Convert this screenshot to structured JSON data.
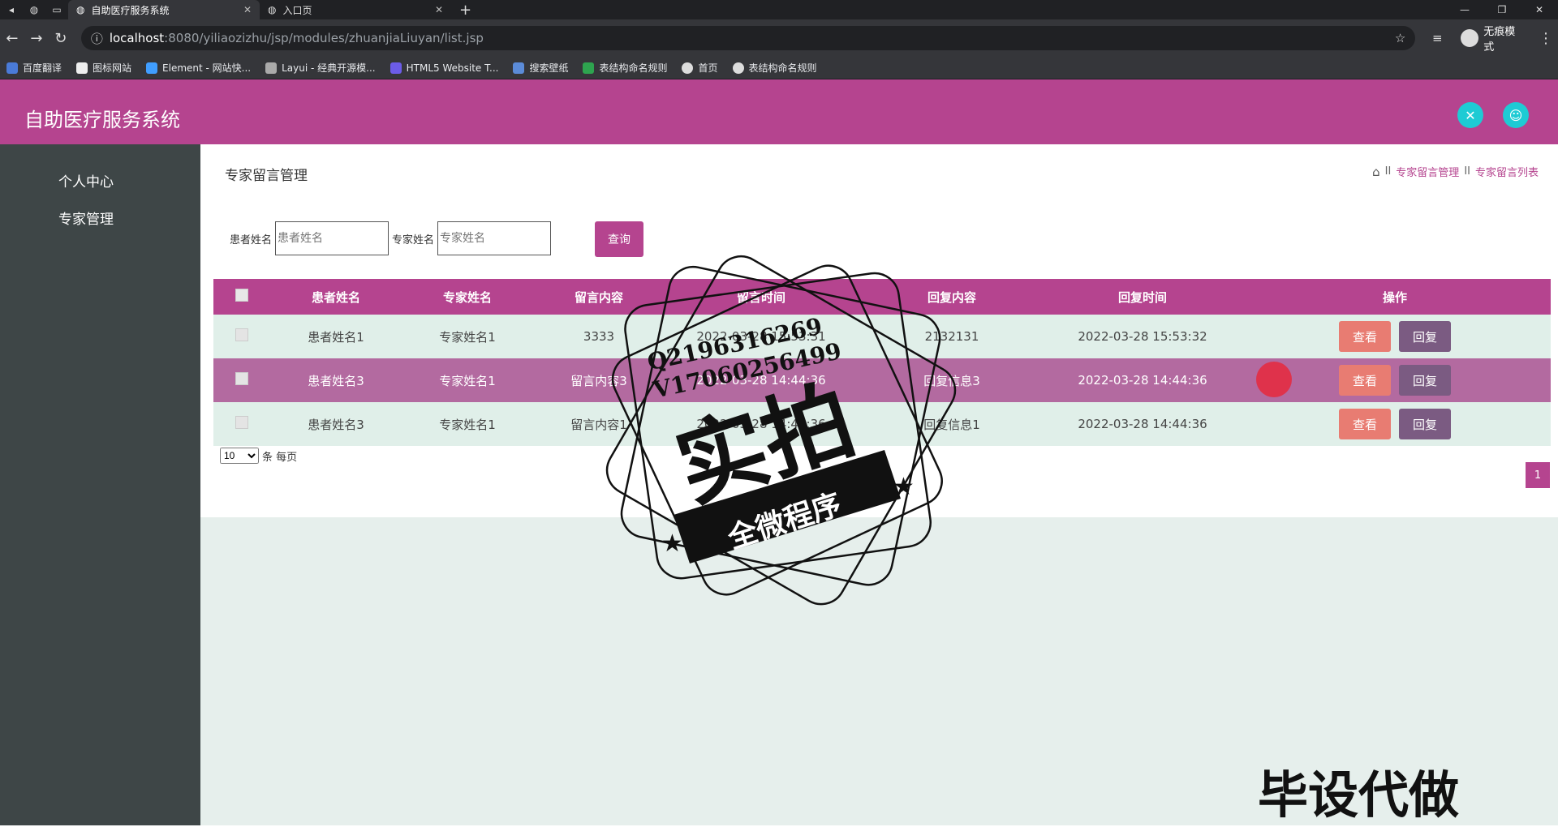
{
  "browser": {
    "tabs": [
      {
        "title": "自助医疗服务系统",
        "active": true
      },
      {
        "title": "入口页",
        "active": false
      }
    ],
    "url_host": "localhost",
    "url_rest": ":8080/yiliaozizhu/jsp/modules/zhuanjiaLiuyan/list.jsp",
    "profile_label": "无痕模式",
    "bookmarks": [
      "百度翻译",
      "图标网站",
      "Element - 网站快...",
      "Layui - 经典开源模...",
      "HTML5 Website T...",
      "搜索壁纸",
      "表结构命名规则",
      "首页",
      "表结构命名规则"
    ]
  },
  "header": {
    "title": "自助医疗服务系统"
  },
  "sidebar": {
    "items": [
      {
        "label": "个人中心"
      },
      {
        "label": "专家管理"
      }
    ]
  },
  "main": {
    "page_title": "专家留言管理",
    "breadcrumb": [
      "专家留言管理",
      "专家留言列表"
    ],
    "breadcrumb_sep": "II",
    "search": {
      "patient_label": "患者姓名",
      "patient_placeholder": "患者姓名",
      "expert_label": "专家姓名",
      "expert_placeholder": "专家姓名",
      "button": "查询"
    },
    "table": {
      "columns": [
        "患者姓名",
        "专家姓名",
        "留言内容",
        "留言时间",
        "回复内容",
        "回复时间",
        "操作"
      ],
      "rows": [
        {
          "patient": "患者姓名1",
          "expert": "专家姓名1",
          "content": "3333",
          "time": "2022-03-28 15:53:31",
          "reply": "2132131",
          "reply_time": "2022-03-28 15:53:32"
        },
        {
          "patient": "患者姓名3",
          "expert": "专家姓名1",
          "content": "留言内容3",
          "time": "2022-03-28 14:44:36",
          "reply": "回复信息3",
          "reply_time": "2022-03-28 14:44:36"
        },
        {
          "patient": "患者姓名3",
          "expert": "专家姓名1",
          "content": "留言内容1",
          "time": "2022-03-28 14:44:36",
          "reply": "回复信息1",
          "reply_time": "2022-03-28 14:44:36"
        }
      ],
      "view_label": "查看",
      "reply_label": "回复"
    },
    "pager": {
      "page_size": "10",
      "suffix": "条 每页",
      "current_page": "1"
    }
  },
  "watermark": {
    "contact_q": "Q2196316269",
    "contact_v": "V17060256499",
    "big": "实拍",
    "ribbon": "全微程序",
    "corner": "毕设代做"
  },
  "colors": {
    "brand": "#b5448f",
    "sidebar": "#3e4647",
    "accent_icon": "#1ecbd4",
    "view_btn": "#e87c72",
    "reply_btn": "#7b5b82"
  }
}
